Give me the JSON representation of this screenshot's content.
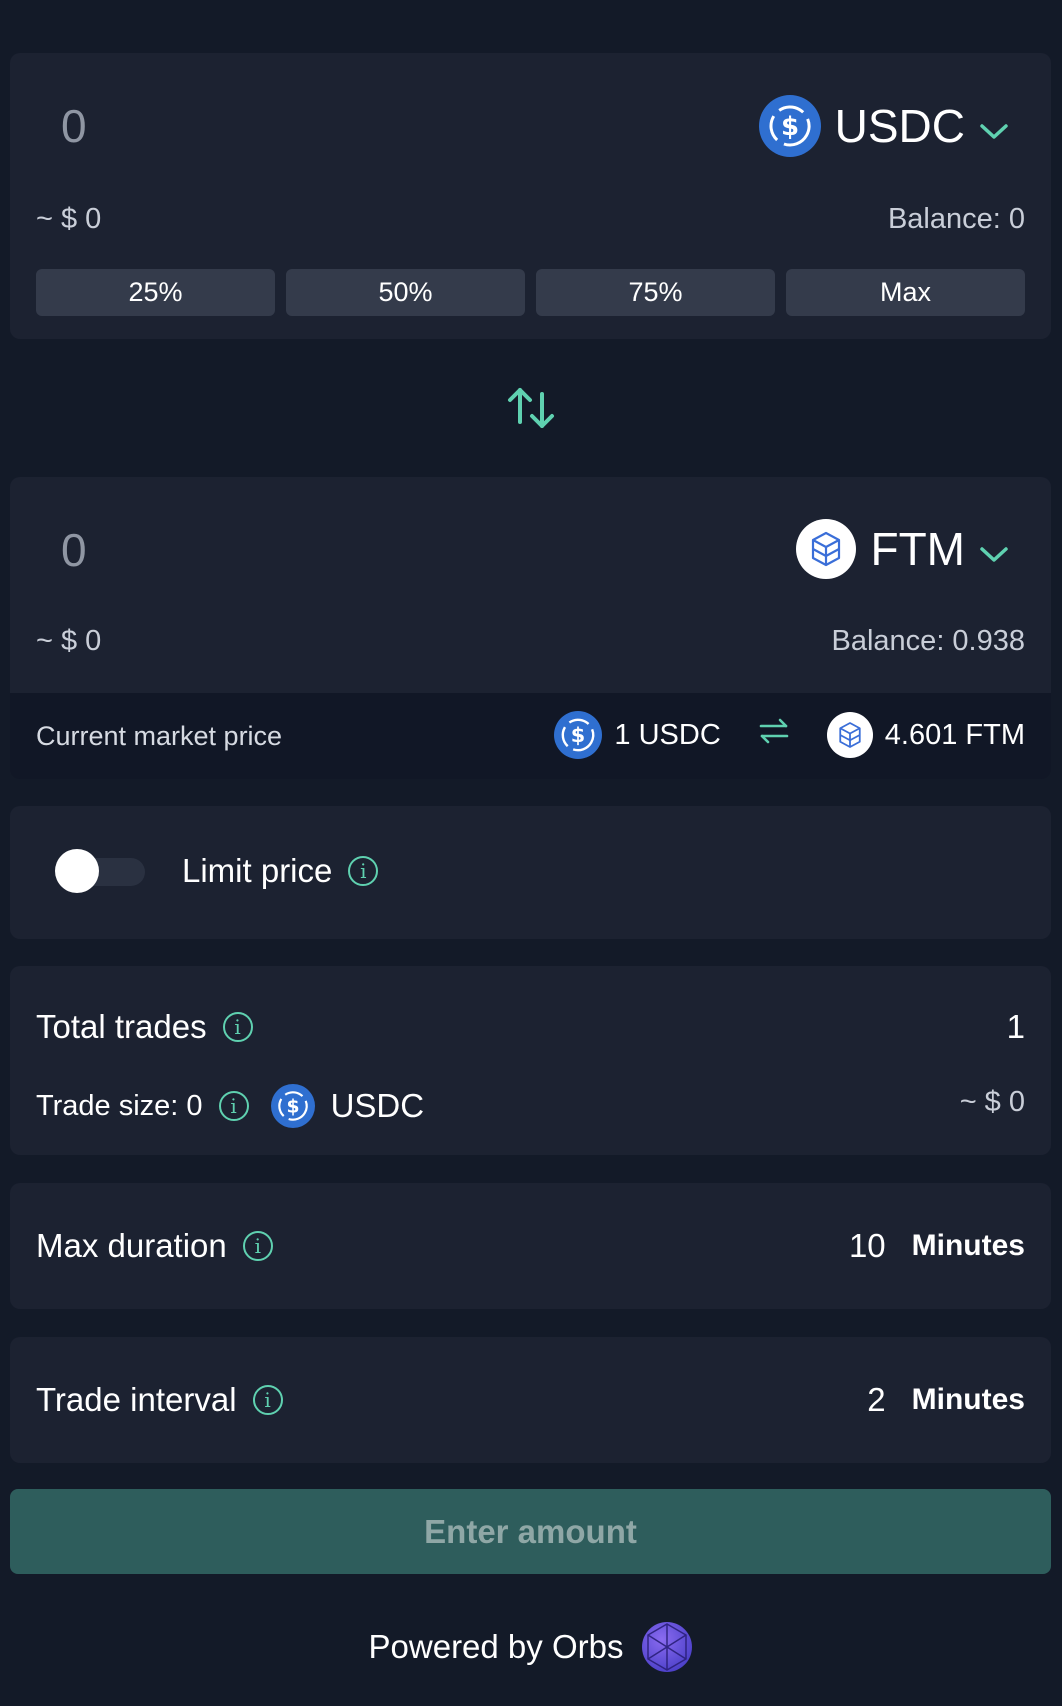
{
  "from": {
    "amount": "0",
    "token": "USDC",
    "usd_value": "~ $ 0",
    "balance": "Balance: 0",
    "percent_buttons": [
      "25%",
      "50%",
      "75%",
      "Max"
    ]
  },
  "to": {
    "amount": "0",
    "token": "FTM",
    "usd_value": "~ $ 0",
    "balance": "Balance: 0.938"
  },
  "market": {
    "label": "Current market price",
    "left": "1 USDC",
    "right": "4.601 FTM"
  },
  "limit": {
    "label": "Limit price",
    "enabled": false
  },
  "trades": {
    "label": "Total trades",
    "value": "1",
    "size_label": "Trade size: 0",
    "size_token": "USDC",
    "size_usd": "~ $ 0"
  },
  "duration": {
    "label": "Max duration",
    "value": "10",
    "unit": "Minutes"
  },
  "interval": {
    "label": "Trade interval",
    "value": "2",
    "unit": "Minutes"
  },
  "submit": {
    "label": "Enter amount"
  },
  "footer": {
    "text": "Powered by Orbs"
  },
  "colors": {
    "accent": "#5fd1b0",
    "background": "#131a28",
    "card": "#1c2231",
    "button": "#2e5d5c",
    "usdc": "#2f6fd0"
  },
  "icons": {
    "info": "i"
  }
}
